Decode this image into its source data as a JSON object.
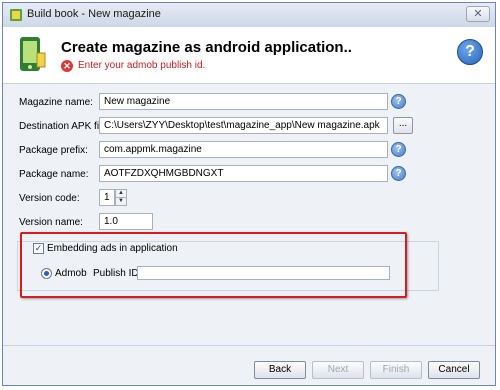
{
  "window": {
    "title": "Build book - New magazine",
    "close_glyph": "✕"
  },
  "header": {
    "title": "Create magazine as android application..",
    "error_text": "Enter your admob publish id.",
    "error_glyph": "✕",
    "help_glyph": "?"
  },
  "form": {
    "magazine_name": {
      "label": "Magazine name:",
      "value": "New magazine"
    },
    "destination": {
      "label": "Destination APK file:",
      "value": "C:\\Users\\ZYY\\Desktop\\test\\magazine_app\\New magazine.apk",
      "browse_label": "..."
    },
    "package_prefix": {
      "label": "Package prefix:",
      "value": "com.appmk.magazine"
    },
    "package_name": {
      "label": "Package name:",
      "value": "AOTFZDXQHMGBDNGXT"
    },
    "version_code": {
      "label": "Version code:",
      "value": "1",
      "up": "▲",
      "down": "▼"
    },
    "version_name": {
      "label": "Version name:",
      "value": "1.0"
    },
    "help_glyph": "?"
  },
  "ads": {
    "embed_label": "Embedding ads in application",
    "embed_checked": true,
    "check_glyph": "✓",
    "provider_label": "Admob",
    "publish_id_label": "Publish ID:",
    "publish_id_value": ""
  },
  "buttons": {
    "back": "Back",
    "next": "Next",
    "finish": "Finish",
    "cancel": "Cancel"
  },
  "colors": {
    "highlight": "#d11f1f",
    "error": "#c22020",
    "help": "#2764b8"
  },
  "icons": {
    "app": "book-icon",
    "header": "android-phone-icon",
    "error": "error-icon",
    "help": "help-icon"
  }
}
